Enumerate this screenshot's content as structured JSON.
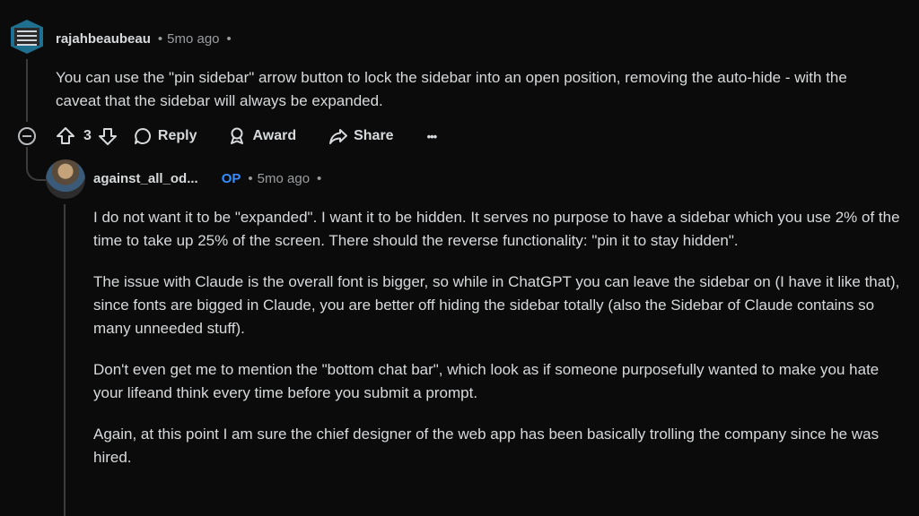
{
  "comment1": {
    "username": "rajahbeaubeau",
    "age": "5mo ago",
    "dot_before": "•",
    "dot_after": "•",
    "body": "You can use the \"pin sidebar\" arrow button to lock the sidebar into an open position, removing the auto-hide - with the caveat that the sidebar will always be expanded.",
    "votes": "3",
    "actions": {
      "reply": "Reply",
      "award": "Award",
      "share": "Share",
      "more": "•••"
    }
  },
  "comment2": {
    "username": "against_all_od...",
    "op_badge": "OP",
    "dot_before": "•",
    "age": "5mo ago",
    "dot_after": "•",
    "paragraphs": [
      "I do not want it to be \"expanded\". I want it to be hidden. It serves no purpose to have a sidebar which you use 2% of the time to take up 25% of the screen. There should the reverse functionality: \"pin it to stay hidden\".",
      "The issue with Claude is the overall font is bigger, so while in ChatGPT you can leave the sidebar on (I have it like that), since fonts are bigged in Claude, you are better off hiding the sidebar totally (also the Sidebar of Claude contains so many unneeded stuff).",
      "Don't even get me to mention the \"bottom chat bar\", which look as if someone purposefully wanted to make you hate your lifeand think every time before you submit a prompt.",
      "Again, at this point I am sure the chief designer of the web app has been basically trolling the company since he was hired."
    ]
  },
  "icons": {
    "upvote": "upvote-icon",
    "downvote": "downvote-icon",
    "reply": "comment-bubble-icon",
    "award": "award-icon",
    "share": "share-arrow-icon",
    "collapse": "collapse-minus-icon"
  },
  "colors": {
    "background": "#0b0b0b",
    "text": "#d7dadc",
    "meta": "#9a9da0",
    "op": "#3a8cff"
  }
}
